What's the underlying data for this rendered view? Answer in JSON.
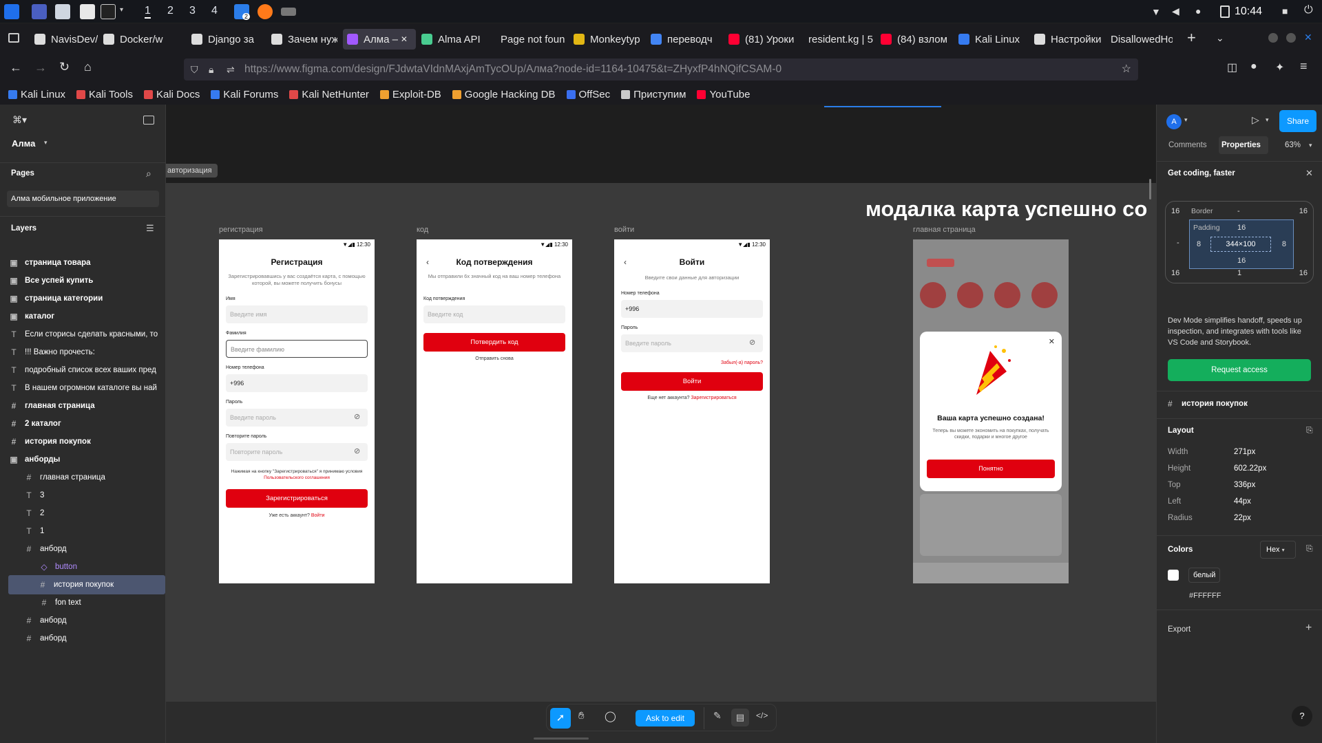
{
  "taskbar": {
    "workspaces": [
      "1",
      "2",
      "3",
      "4"
    ],
    "badge": "2",
    "clock": "10:44"
  },
  "tabs": [
    {
      "label": "NavisDev/",
      "color": "#dddddd"
    },
    {
      "label": "Docker/w",
      "color": "#dddddd"
    },
    {
      "label": "Django за",
      "color": "#dddddd"
    },
    {
      "label": "Зачем нуж",
      "color": "#dddddd"
    },
    {
      "label": "Алма – ",
      "color": "#a259ff"
    },
    {
      "label": "Alma API",
      "color": "#49cc90"
    },
    {
      "label": "Page not foun",
      "color": ""
    },
    {
      "label": "Monkeytyp",
      "color": "#e2b714"
    },
    {
      "label": "переводч",
      "color": "#4285f4"
    },
    {
      "label": "(81) Уроки",
      "color": "#ff0033"
    },
    {
      "label": "resident.kg | 5",
      "color": ""
    },
    {
      "label": "(84) взлом",
      "color": "#ff0033"
    },
    {
      "label": "Kali Linux",
      "color": "#367bf0"
    },
    {
      "label": "Настройки",
      "color": "#dddddd"
    },
    {
      "label": "DisallowedHo",
      "color": ""
    }
  ],
  "url": "https://www.figma.com/design/FJdwtaVIdnMAxjAmTycOUp/Алма?node-id=1164-10475&t=ZHyxfP4hNQifCSAM-0",
  "bookmarks": [
    {
      "label": "Kali Linux",
      "color": "#367bf0"
    },
    {
      "label": "Kali Tools",
      "color": "#e04848"
    },
    {
      "label": "Kali Docs",
      "color": "#e04848"
    },
    {
      "label": "Kali Forums",
      "color": "#367bf0"
    },
    {
      "label": "Kali NetHunter",
      "color": "#e04848"
    },
    {
      "label": "Exploit-DB",
      "color": "#f0a030"
    },
    {
      "label": "Google Hacking DB",
      "color": "#f0a030"
    },
    {
      "label": "OffSec",
      "color": "#3a6ff0"
    },
    {
      "label": "Приступим",
      "color": "#cccccc"
    },
    {
      "label": "YouTube",
      "color": "#ff0033"
    }
  ],
  "left": {
    "project": "Алма",
    "pages_title": "Pages",
    "page": "Алма мобильное приложение",
    "layers_title": "Layers",
    "layers": [
      {
        "icon": "▣",
        "label": "страница товара",
        "indent": 0,
        "bold": true
      },
      {
        "icon": "▣",
        "label": "Все успей купить",
        "indent": 0,
        "bold": true
      },
      {
        "icon": "▣",
        "label": "страница категории",
        "indent": 0,
        "bold": true
      },
      {
        "icon": "▣",
        "label": "каталог",
        "indent": 0,
        "bold": true
      },
      {
        "icon": "T",
        "label": "Если сторисы сделать красными, то",
        "indent": 0,
        "bold": false
      },
      {
        "icon": "T",
        "label": "!!! Важно прочесть:",
        "indent": 0,
        "bold": false
      },
      {
        "icon": "T",
        "label": "подробный список всех ваших пред",
        "indent": 0,
        "bold": false
      },
      {
        "icon": "T",
        "label": "В нашем огромном каталоге вы най",
        "indent": 0,
        "bold": false
      },
      {
        "icon": "#",
        "label": "главная страница",
        "indent": 0,
        "bold": true
      },
      {
        "icon": "#",
        "label": "2 каталог",
        "indent": 0,
        "bold": true
      },
      {
        "icon": "#",
        "label": "история покупок",
        "indent": 0,
        "bold": true
      },
      {
        "icon": "▣",
        "label": "анборды",
        "indent": 0,
        "bold": true
      },
      {
        "icon": "#",
        "label": "главная страница",
        "indent": 1,
        "bold": false
      },
      {
        "icon": "T",
        "label": "3",
        "indent": 1,
        "bold": false
      },
      {
        "icon": "T",
        "label": "2",
        "indent": 1,
        "bold": false
      },
      {
        "icon": "T",
        "label": "1",
        "indent": 1,
        "bold": false
      },
      {
        "icon": "#",
        "label": "анборд",
        "indent": 1,
        "bold": false
      },
      {
        "icon": "◇",
        "label": "button",
        "indent": 2,
        "bold": false,
        "purple": true
      },
      {
        "icon": "#",
        "label": "история покупок",
        "indent": 2,
        "bold": false,
        "selected": true
      },
      {
        "icon": "#",
        "label": "fon text",
        "indent": 2,
        "bold": false
      },
      {
        "icon": "#",
        "label": "анборд",
        "indent": 1,
        "bold": false
      },
      {
        "icon": "#",
        "label": "анборд",
        "indent": 1,
        "bold": false
      }
    ]
  },
  "canvas": {
    "section_label": "авторизация",
    "big_title": "модалка карта успешно со",
    "frames": [
      "регистрация",
      "код",
      "войти",
      "главная страница"
    ],
    "status_time": "12:30",
    "reg": {
      "title": "Регистрация",
      "subtitle": "Зарегистрировавшись у вас создаётся карта, с помощью которой, вы можете получить бонусы",
      "name_label": "Имя",
      "name_ph": "Введите имя",
      "surname_label": "Фамилия",
      "surname_ph": "Введите фамилию",
      "phone_label": "Номер телефона",
      "phone_val": "+996",
      "pass_label": "Пароль",
      "pass_ph": "Введите пароль",
      "pass2_label": "Повторите пароль",
      "pass2_ph": "Повторите пароль",
      "terms": "Нажимая на кнопку \"Зарегистрироваться\" я принимаю условия",
      "terms_link": "Пользовательского соглашения",
      "button": "Зарегистрироваться",
      "have_account": "Уже есть аккаунт?",
      "login_link": "Войти"
    },
    "code": {
      "title": "Код потверждения",
      "subtitle": "Мы отправили 6х значный код на ваш номер телефона",
      "label": "Код потверждения",
      "ph": "Введите код",
      "button": "Потвердить код",
      "resend": "Отправить снова"
    },
    "login": {
      "title": "Войти",
      "subtitle": "Введите свои данные для авторизации",
      "phone_label": "Номер телефона",
      "phone_val": "+996",
      "pass_label": "Пароль",
      "pass_ph": "Введите пароль",
      "forgot": "Забыл(-а) пароль?",
      "button": "Войти",
      "no_account": "Еще нет аккаунта?",
      "register_link": "Зарегистрироваться"
    },
    "modal": {
      "title": "Ваша карта успешно создана!",
      "text": "Теперь вы можете экономить на покупках, получать скидки, подарки и многое другое",
      "button": "Понятно"
    },
    "brand_color": "#e0000f"
  },
  "bottom": {
    "ask": "Ask to edit"
  },
  "right": {
    "avatar": "A",
    "share": "Share",
    "tabs": [
      "Comments",
      "Properties"
    ],
    "zoom": "63%",
    "promo_title": "Get coding, faster",
    "box": {
      "outer": "16",
      "border": "Border",
      "dash": "-",
      "padding": "Padding",
      "pad": "16",
      "side": "8",
      "size": "344×100",
      "bottom_val": "1"
    },
    "promo_text": "Dev Mode simplifies handoff, speeds up inspection, and integrates with tools like VS Code and Storybook.",
    "request": "Request access",
    "selection": "история покупок",
    "layout_title": "Layout",
    "layout": [
      {
        "k": "Width",
        "v": "271px"
      },
      {
        "k": "Height",
        "v": "602.22px"
      },
      {
        "k": "Top",
        "v": "336px"
      },
      {
        "k": "Left",
        "v": "44px"
      },
      {
        "k": "Radius",
        "v": "22px"
      }
    ],
    "colors_title": "Colors",
    "hex": "Hex",
    "color_name": "белый",
    "color_hex": "#FFFFFF",
    "export": "Export",
    "help": "?"
  }
}
